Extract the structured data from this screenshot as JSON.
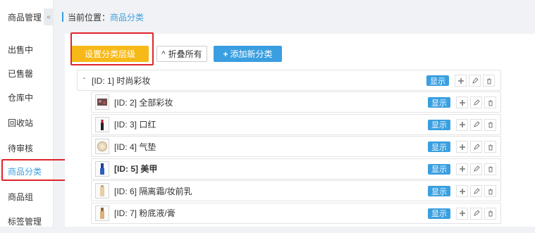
{
  "sidebar": {
    "header": "商品管理",
    "collapse_glyph": "«",
    "items": [
      {
        "label": "出售中"
      },
      {
        "label": "已售罄"
      },
      {
        "label": "仓库中"
      },
      {
        "label": "回收站"
      },
      {
        "label": "待审核"
      },
      {
        "label": "商品分类",
        "active": true
      },
      {
        "label": "商品组"
      },
      {
        "label": "标签管理"
      }
    ]
  },
  "breadcrumb": {
    "label": "当前位置：",
    "current": "商品分类"
  },
  "toolbar": {
    "set_level_label": "设置分类层级",
    "fold_all_label": "折叠所有",
    "fold_glyph": "^",
    "add_label": "添加新分类",
    "add_glyph": "+"
  },
  "tree": {
    "root": {
      "toggle": "-",
      "label": "[ID: 1] 时尚彩妆",
      "badge": "显示"
    },
    "children": [
      {
        "id_label": "[ID: 2] 全部彩妆",
        "badge": "显示",
        "thumb": "palette",
        "bold": false
      },
      {
        "id_label": "[ID: 3] 口红",
        "badge": "显示",
        "thumb": "lipstick",
        "bold": false
      },
      {
        "id_label": "[ID: 4] 气垫",
        "badge": "显示",
        "thumb": "cushion",
        "bold": false
      },
      {
        "id_label": "[ID: 5] 美甲",
        "badge": "显示",
        "thumb": "nail",
        "bold": true
      },
      {
        "id_label": "[ID: 6] 隔离霜/妆前乳",
        "badge": "显示",
        "thumb": "primer",
        "bold": false
      },
      {
        "id_label": "[ID: 7] 粉底液/膏",
        "badge": "显示",
        "thumb": "foundation",
        "bold": false
      }
    ]
  },
  "colors": {
    "accent": "#3a9fe0",
    "primary_button": "#f7b917",
    "highlight_frame": "#e0242a"
  }
}
